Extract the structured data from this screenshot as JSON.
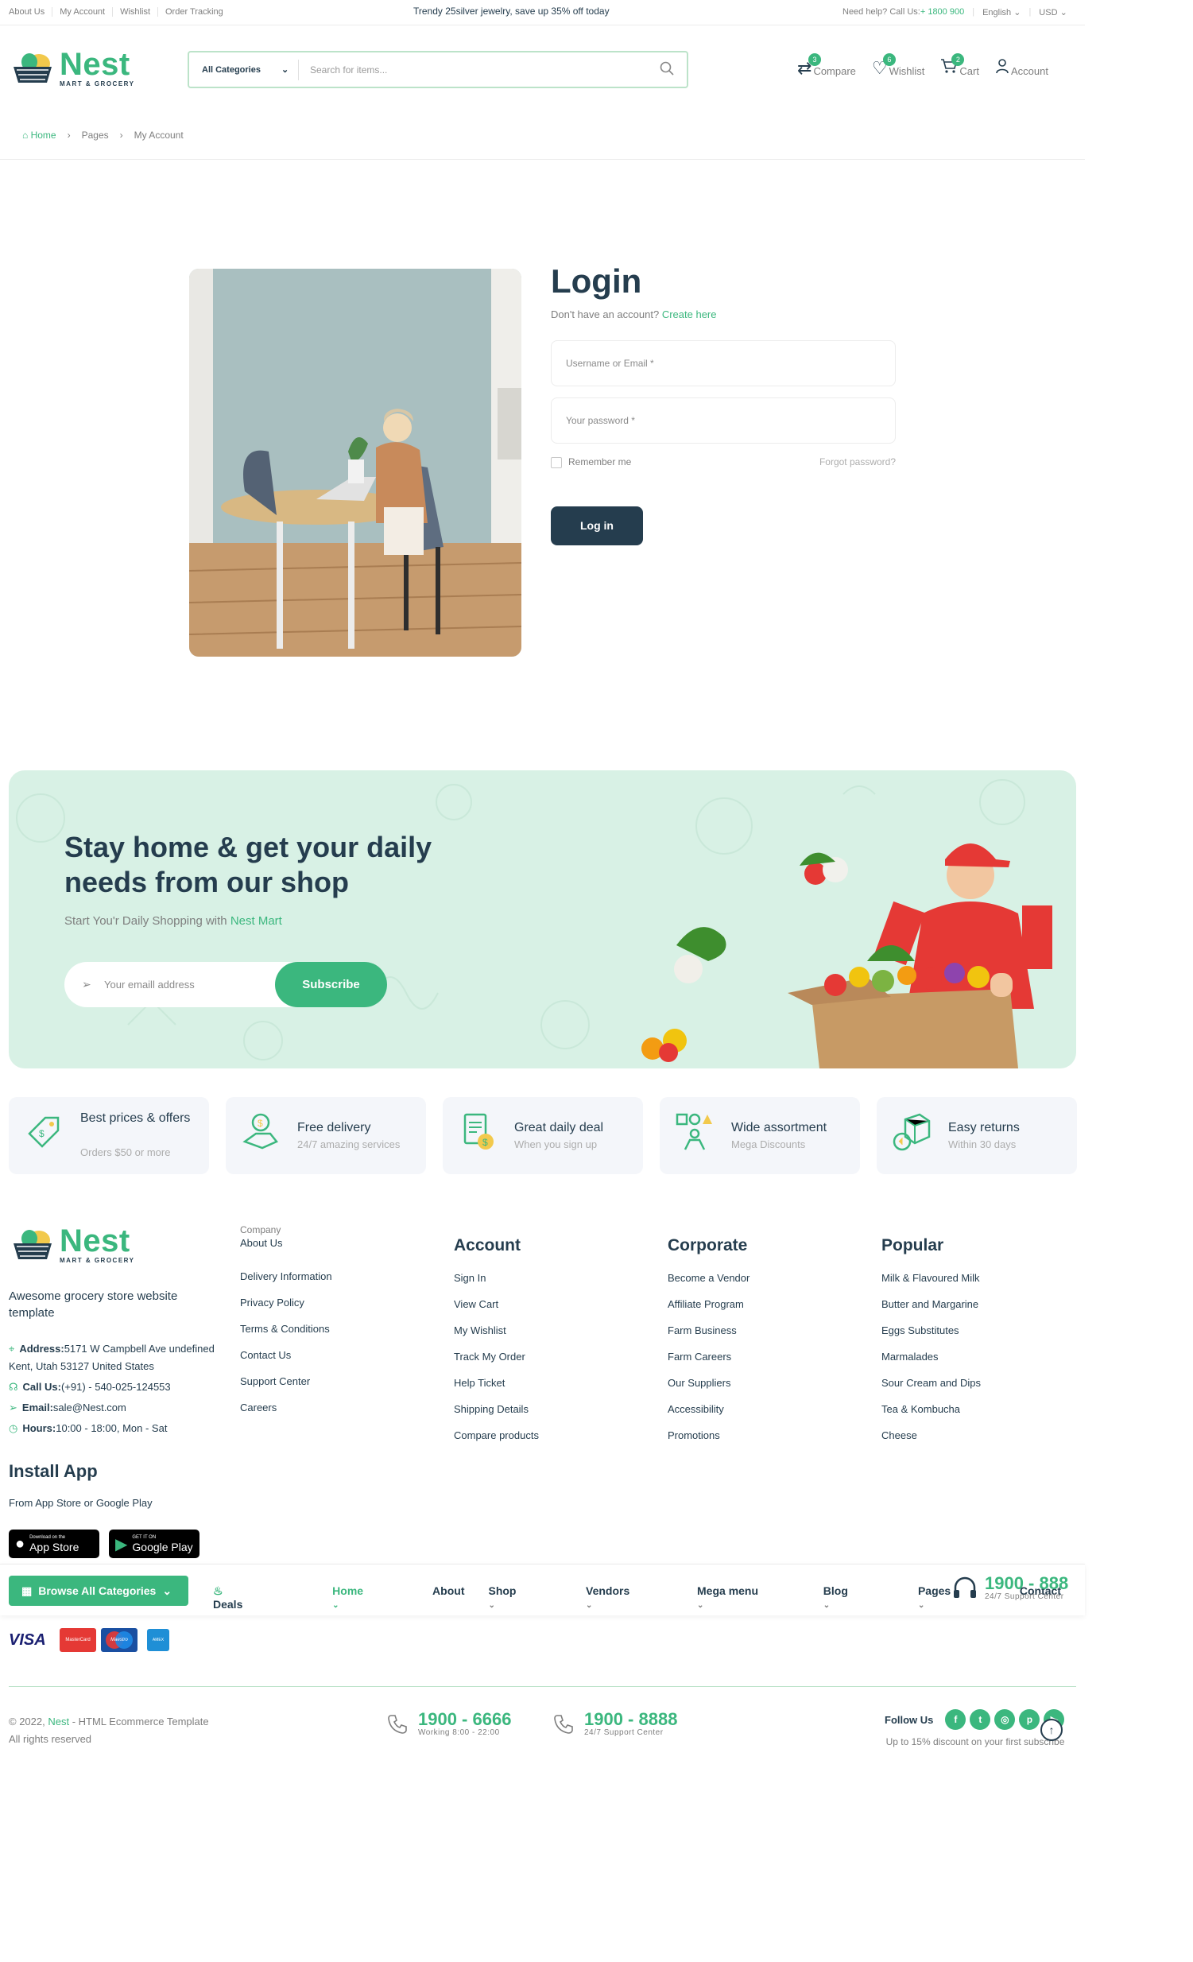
{
  "topbar": {
    "links": [
      "About Us",
      "My Account",
      "Wishlist",
      "Order Tracking"
    ],
    "promo": "Trendy 25silver jewelry, save up 35% off today",
    "help_prefix": "Need help? Call Us:",
    "help_phone": "+ 1800 900",
    "language": "English",
    "currency": "USD"
  },
  "logo": {
    "name": "Nest",
    "tagline": "MART & GROCERY"
  },
  "search": {
    "category": "All Categories",
    "placeholder": "Search for items..."
  },
  "header_actions": [
    {
      "label": "Compare",
      "icon": "compare-icon",
      "badge": "3"
    },
    {
      "label": "Wishlist",
      "icon": "heart-icon",
      "badge": "6"
    },
    {
      "label": "Cart",
      "icon": "cart-icon",
      "badge": "2"
    },
    {
      "label": "Account",
      "icon": "user-icon",
      "badge": ""
    }
  ],
  "breadcrumb": [
    "Home",
    "Pages",
    "My Account"
  ],
  "login": {
    "title": "Login",
    "no_account": "Don't have an account?",
    "create_link": "Create here",
    "username_placeholder": "Username or Email *",
    "password_placeholder": "Your password *",
    "remember": "Remember me",
    "forgot": "Forgot password?",
    "submit": "Log in"
  },
  "banner": {
    "title": "Stay home & get your daily needs from our shop",
    "subtitle_prefix": "Start You'r Daily Shopping with ",
    "subtitle_brand": "Nest Mart",
    "email_placeholder": "Your emaill address",
    "subscribe": "Subscribe"
  },
  "features": [
    {
      "title": "Best prices & offers",
      "desc": "Orders $50 or more",
      "icon": "price-tag-icon"
    },
    {
      "title": "Free delivery",
      "desc": "24/7 amazing services",
      "icon": "delivery-icon"
    },
    {
      "title": "Great daily deal",
      "desc": "When you sign up",
      "icon": "deal-icon"
    },
    {
      "title": "Wide assortment",
      "desc": "Mega Discounts",
      "icon": "assortment-icon"
    },
    {
      "title": "Easy returns",
      "desc": "Within 30 days",
      "icon": "returns-icon"
    }
  ],
  "footer": {
    "about": "Awesome grocery store website template",
    "address_label": "Address:",
    "address": "5171 W Campbell Ave undefined Kent, Utah 53127 United States",
    "call_label": "Call Us:",
    "call": "(+91) - 540-025-124553",
    "email_label": "Email:",
    "email": "sale@Nest.com",
    "hours_label": "Hours:",
    "hours": "10:00 - 18:00, Mon - Sat",
    "install_title": "Install App",
    "install_sub": "From App Store or Google Play",
    "appstore_small": "Download on the",
    "appstore": "App Store",
    "googleplay_small": "GET IT ON",
    "googleplay": "Google Play",
    "company": {
      "title": "Company",
      "links": [
        "About Us",
        "Delivery Information",
        "Privacy Policy",
        "Terms & Conditions",
        "Contact Us",
        "Support Center",
        "Careers"
      ]
    },
    "account": {
      "title": "Account",
      "links": [
        "Sign In",
        "View Cart",
        "My Wishlist",
        "Track My Order",
        "Help Ticket",
        "Shipping Details",
        "Compare products"
      ]
    },
    "corporate": {
      "title": "Corporate",
      "links": [
        "Become a Vendor",
        "Affiliate Program",
        "Farm Business",
        "Farm Careers",
        "Our Suppliers",
        "Accessibility",
        "Promotions"
      ]
    },
    "popular": {
      "title": "Popular",
      "links": [
        "Milk & Flavoured Milk",
        "Butter and Margarine",
        "Eggs Substitutes",
        "Marmalades",
        "Sour Cream and Dips",
        "Tea & Kombucha",
        "Cheese"
      ]
    }
  },
  "navbar": {
    "browse": "Browse All Categories",
    "deals": "Deals",
    "links": [
      {
        "label": "Home",
        "dropdown": true,
        "active": true
      },
      {
        "label": "About",
        "dropdown": false
      },
      {
        "label": "Shop",
        "dropdown": true
      },
      {
        "label": "Vendors",
        "dropdown": true
      },
      {
        "label": "Mega menu",
        "dropdown": true
      },
      {
        "label": "Blog",
        "dropdown": true
      },
      {
        "label": "Pages",
        "dropdown": true
      },
      {
        "label": "Contact",
        "dropdown": false
      }
    ],
    "support_phone": "1900 - 888",
    "support_label": "24/7 Support Center"
  },
  "payment": [
    "VISA",
    "MasterCard",
    "Maestro",
    "AMEX"
  ],
  "bottom": {
    "copy_prefix": "© 2022, ",
    "copy_brand": "Nest",
    "copy_suffix": " - HTML Ecommerce Template",
    "rights": "All rights reserved",
    "phone1": "1900 - 6666",
    "phone1_label": "Working 8:00 - 22:00",
    "phone2": "1900 - 8888",
    "phone2_label": "24/7 Support Center",
    "follow": "Follow Us",
    "discount": "Up to 15% discount on your first subscribe"
  },
  "colors": {
    "brand": "#3BB77E",
    "dark": "#253D4E",
    "banner": "#D8F1E5"
  }
}
